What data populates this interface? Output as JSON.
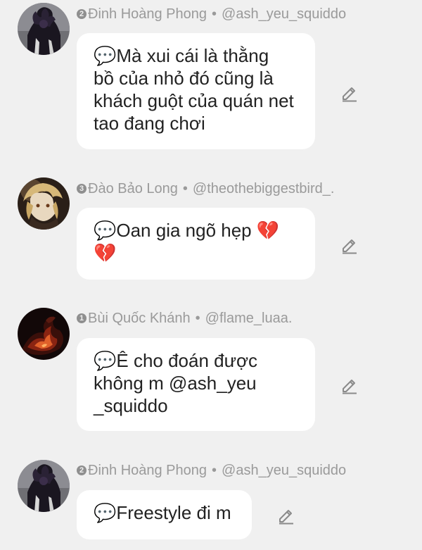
{
  "messages": [
    {
      "rank": "2",
      "name": "Đinh Hoàng Phong",
      "separator": "•",
      "handle": "@ash_yeu_squiddo",
      "text": "💬Mà xui cái là thằng\nbồ của nhỏ đó cũng là\nkhách guột của quán net\ntao đang chơi",
      "avatar_icon": "dark-figure-avatar"
    },
    {
      "rank": "3",
      "name": "Đào Bảo Long",
      "separator": "•",
      "handle": "@theothebiggestbird_.",
      "text": "💬Oan gia ngõ hẹp 💔\n💔",
      "avatar_icon": "blonde-anime-avatar"
    },
    {
      "rank": "1",
      "name": "Bùi Quốc Khánh",
      "separator": "•",
      "handle": "@flame_luaa.",
      "text": "💬Ê cho đoán được\nkhông m @ash_yeu\n_squiddo",
      "avatar_icon": "flame-avatar"
    },
    {
      "rank": "2",
      "name": "Đinh Hoàng Phong",
      "separator": "•",
      "handle": "@ash_yeu_squiddo",
      "text": "💬Freestyle đi m",
      "avatar_icon": "dark-figure-avatar"
    }
  ],
  "colors": {
    "background": "#f0f0f0",
    "bubble": "#ffffff",
    "meta_text": "#9a9a9a",
    "message_text": "#222222",
    "icon": "#8a8a8a"
  },
  "icons": {
    "edit": "pencil-edit-icon"
  }
}
